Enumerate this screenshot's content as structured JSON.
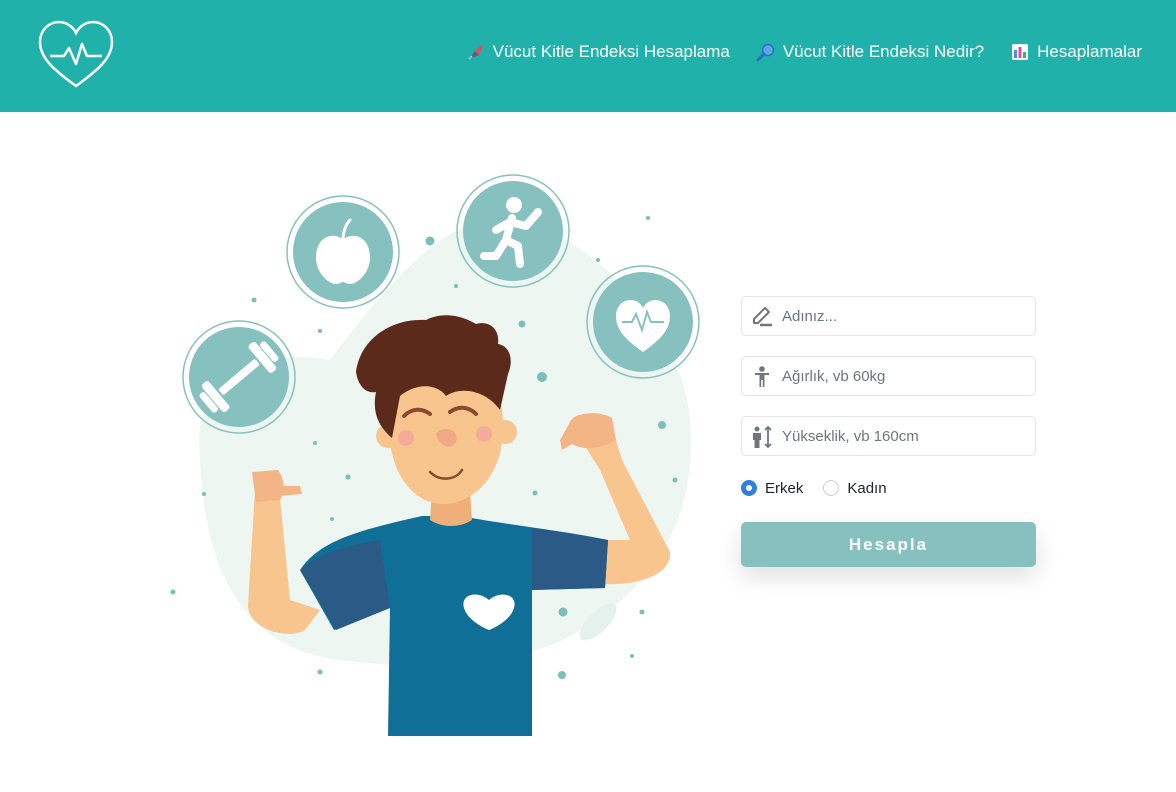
{
  "nav": {
    "logo_icon": "heart-pulse-icon",
    "links": [
      {
        "label": "Vücut Kitle Endeksi Hesaplama",
        "icon": "fountain-pen-icon"
      },
      {
        "label": "Vücut Kitle Endeksi Nedir?",
        "icon": "magnifier-icon"
      },
      {
        "label": "Hesaplamalar",
        "icon": "bar-chart-icon"
      }
    ]
  },
  "form": {
    "name_placeholder": "Adınız...",
    "weight_placeholder": "Ağırlık, vb 60kg",
    "height_placeholder": "Yükseklik, vb 160cm",
    "gender_options": [
      {
        "label": "Erkek",
        "checked": true
      },
      {
        "label": "Kadın",
        "checked": false
      }
    ],
    "submit_label": "Hesapla"
  },
  "colors": {
    "header": "#20b2aa",
    "accent": "#86c1bf",
    "radio_checked": "#2f80d8"
  }
}
